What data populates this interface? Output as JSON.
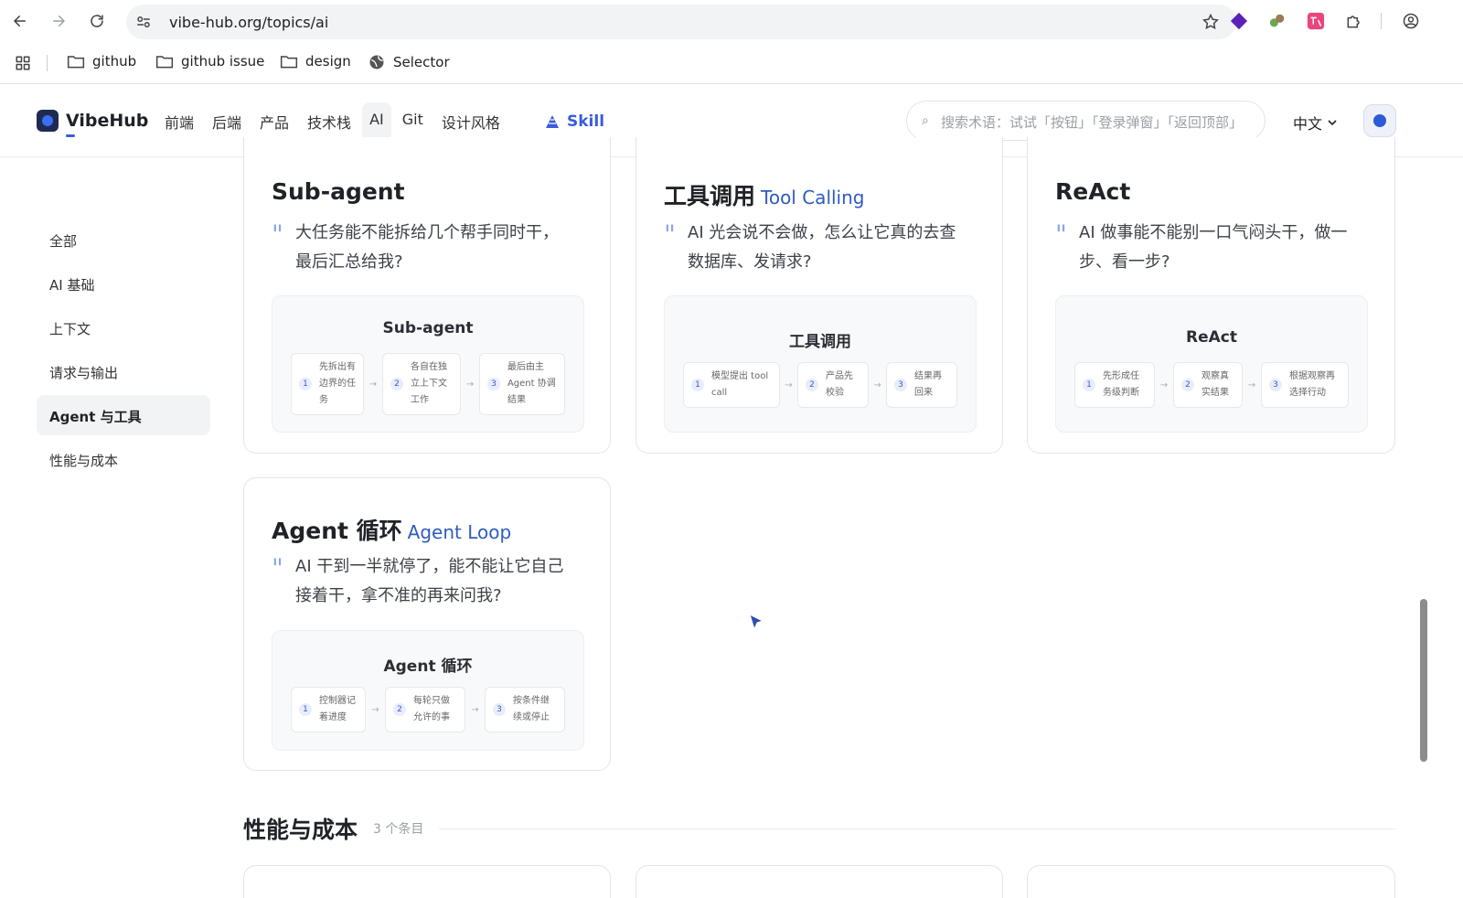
{
  "browser": {
    "url": "vibe-hub.org/topics/ai",
    "bookmarks": [
      {
        "label": "github",
        "icon": "folder-icon"
      },
      {
        "label": "github issue",
        "icon": "folder-icon"
      },
      {
        "label": "design",
        "icon": "folder-icon"
      },
      {
        "label": "Selector",
        "icon": "globe-icon"
      }
    ]
  },
  "header": {
    "logo": "VibeHub",
    "nav": [
      "前端",
      "后端",
      "产品",
      "技术栈",
      "AI",
      "Git",
      "设计风格"
    ],
    "active_nav": "AI",
    "skill": "Skill",
    "search_placeholder": "搜索术语：试试「按钮」「登录弹窗」「返回顶部」",
    "lang": "中文"
  },
  "sidebar": {
    "items": [
      "全部",
      "AI 基础",
      "上下文",
      "请求与输出",
      "Agent 与工具",
      "性能与成本"
    ],
    "active": "Agent 与工具"
  },
  "cards": [
    {
      "title": "Sub-agent",
      "en": "",
      "quote": "大任务能不能拆给几个帮手同时干，最后汇总给我?",
      "diagram_title": "Sub-agent",
      "steps": [
        {
          "n": "1",
          "text": "先拆出有边界的任务"
        },
        {
          "n": "2",
          "text": "各自在独立上下文工作"
        },
        {
          "n": "3",
          "text": "最后由主 Agent 协调结果"
        }
      ]
    },
    {
      "title": "工具调用",
      "en": "Tool Calling",
      "quote": "AI 光会说不会做，怎么让它真的去查数据库、发请求?",
      "diagram_title": "工具调用",
      "steps": [
        {
          "n": "1",
          "text": "模型提出 tool call"
        },
        {
          "n": "2",
          "text": "产品先校验"
        },
        {
          "n": "3",
          "text": "结果再回来"
        }
      ]
    },
    {
      "title": "ReAct",
      "en": "",
      "quote": "AI 做事能不能别一口气闷头干，做一步、看一步?",
      "diagram_title": "ReAct",
      "steps": [
        {
          "n": "1",
          "text": "先形成任务级判断"
        },
        {
          "n": "2",
          "text": "观察真实结果"
        },
        {
          "n": "3",
          "text": "根据观察再选择行动"
        }
      ]
    },
    {
      "title": "Agent 循环",
      "en": "Agent Loop",
      "quote": "AI 干到一半就停了，能不能让它自己接着干，拿不准的再来问我?",
      "diagram_title": "Agent 循环",
      "steps": [
        {
          "n": "1",
          "text": "控制器记着进度"
        },
        {
          "n": "2",
          "text": "每轮只做允许的事"
        },
        {
          "n": "3",
          "text": "按条件继续或停止"
        }
      ]
    }
  ],
  "next_section": {
    "title": "性能与成本",
    "count": "3 个条目"
  }
}
